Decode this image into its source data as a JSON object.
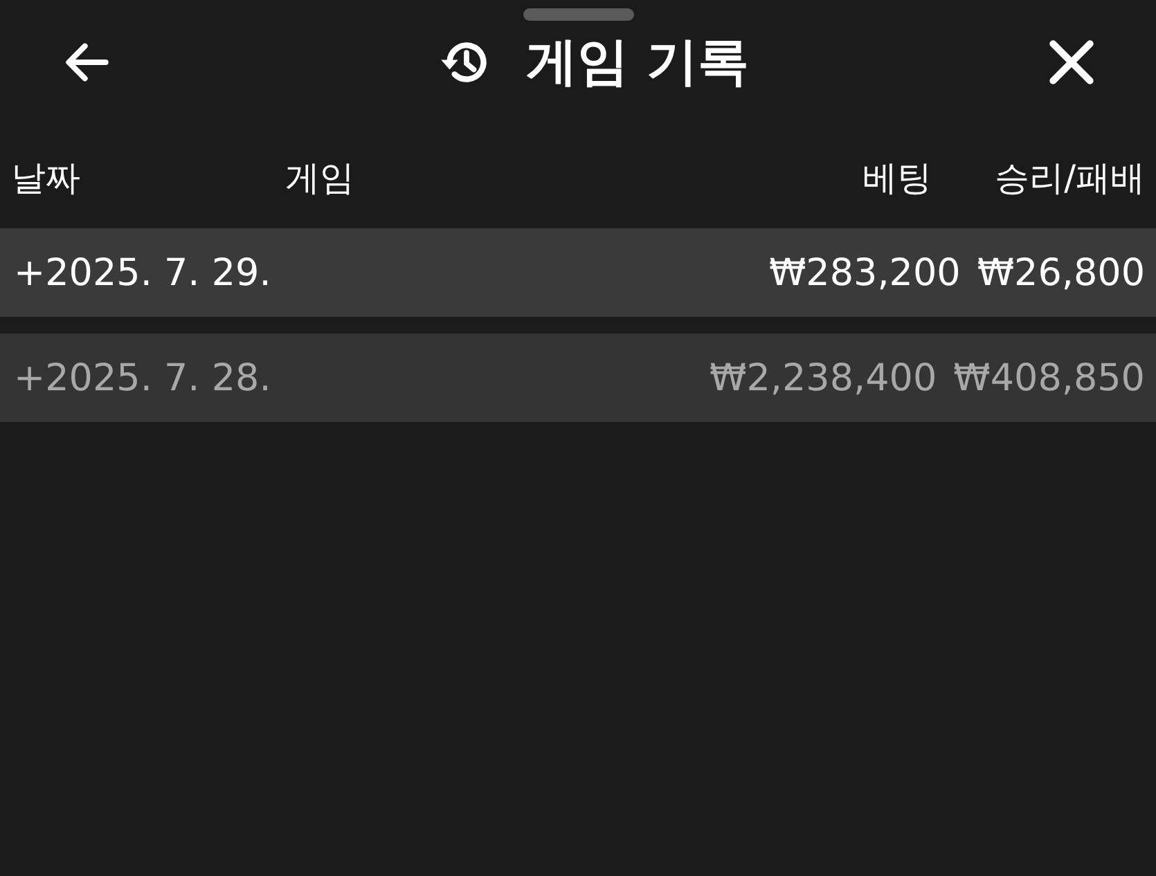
{
  "header": {
    "title": "게임 기록"
  },
  "table": {
    "columns": [
      "날짜",
      "게임",
      "베팅",
      "승리/패배"
    ],
    "rows": [
      {
        "date": "+2025. 7. 29.",
        "bet": "₩283,200",
        "result": "₩26,800",
        "dimmed": false
      },
      {
        "date": "+2025. 7. 28.",
        "bet": "₩2,238,400",
        "result": "₩408,850",
        "dimmed": true
      }
    ]
  }
}
